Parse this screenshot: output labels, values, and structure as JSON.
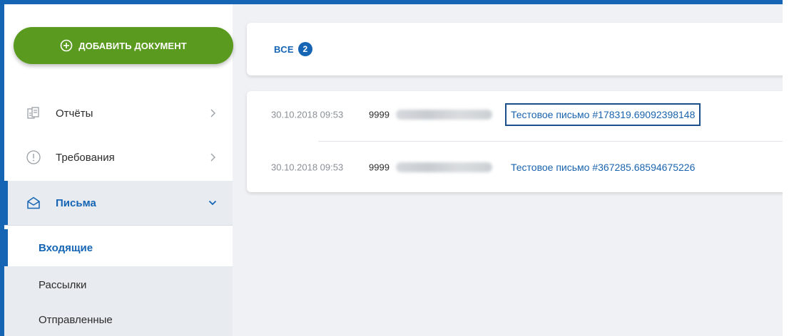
{
  "sidebar": {
    "add_button_label": "ДОБАВИТЬ ДОКУМЕНТ",
    "items": [
      {
        "label": "Отчёты",
        "icon": "report-icon"
      },
      {
        "label": "Требования",
        "icon": "alert-circle-icon"
      },
      {
        "label": "Письма",
        "icon": "envelope-icon",
        "active": true
      }
    ],
    "sub_items": [
      {
        "label": "Входящие",
        "selected": true
      },
      {
        "label": "Рассылки"
      },
      {
        "label": "Отправленные"
      }
    ]
  },
  "header": {
    "tab_all_label": "ВСЕ",
    "tab_all_count": "2"
  },
  "messages": [
    {
      "date": "30.10.2018 09:53",
      "sender_code": "9999",
      "subject": "Тестовое письмо #178319.69092398148",
      "focused": true
    },
    {
      "date": "30.10.2018 09:53",
      "sender_code": "9999",
      "subject": "Тестовое письмо #367285.68594675226"
    }
  ],
  "colors": {
    "accent": "#1565b4",
    "add_button": "#5a9a1f",
    "background": "#f0f1f4"
  }
}
